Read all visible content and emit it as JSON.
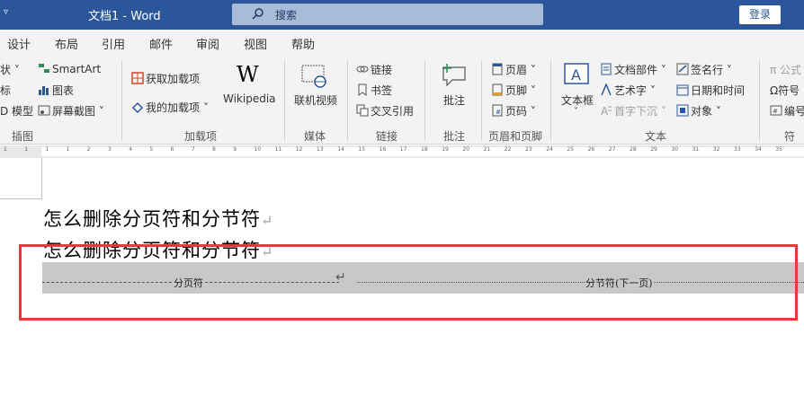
{
  "window": {
    "caret": "▿",
    "title": "文档1  -  Word",
    "search_label": "搜索",
    "login_label": "登录"
  },
  "tabs": [
    "设计",
    "布局",
    "引用",
    "邮件",
    "审阅",
    "视图",
    "帮助"
  ],
  "ribbon": {
    "illustrations": {
      "items": [
        "状 ˅",
        "标",
        "D 模型",
        "SmartArt",
        "图表",
        "屏幕截图 ˅"
      ],
      "group_label": "插图"
    },
    "addins": {
      "get_addins": "获取加载项",
      "my_addins": "我的加载项",
      "wikipedia_glyph": "W",
      "wikipedia": "Wikipedia",
      "group_label": "加载项"
    },
    "media": {
      "online_video": "联机视频",
      "group_label": "媒体"
    },
    "links": {
      "link": "链接",
      "bookmark": "书签",
      "cross_ref": "交叉引用",
      "group_label": "链接"
    },
    "comments": {
      "comment": "批注",
      "group_label": "批注"
    },
    "header_footer": {
      "header": "页眉 ˅",
      "footer": "页脚 ˅",
      "page_number": "页码 ˅",
      "group_label": "页眉和页脚"
    },
    "text": {
      "textbox": "文本框",
      "quick_parts": "文档部件 ˅",
      "wordart": "艺术字 ˅",
      "dropcap": "首字下沉 ˅",
      "signature": "签名行 ˅",
      "datetime": "日期和时间",
      "object": "对象 ˅",
      "group_label": "文本"
    },
    "symbols": {
      "equation": "公式",
      "symbol": "符号",
      "number": "编号",
      "group_label": "符号"
    }
  },
  "ruler": [
    "1",
    "1",
    "1",
    "1",
    "2",
    "3",
    "4",
    "5",
    "6",
    "7",
    "8",
    "9",
    "10",
    "11",
    "12",
    "13",
    "14",
    "15",
    "16",
    "17",
    "18",
    "19",
    "20",
    "21",
    "22",
    "23",
    "24",
    "25",
    "26",
    "27",
    "28",
    "29",
    "30",
    "31",
    "32",
    "33",
    "34",
    "35"
  ],
  "document": {
    "line1": "怎么删除分页符和分节符",
    "line2": "怎么删除分页符和分节符",
    "para_mark": "↵",
    "page_break": "分页符",
    "section_break": "分节符(下一页)"
  },
  "colors": {
    "titlebar": "#2b579a",
    "highlight_box": "#e53b3b",
    "break_bg": "#c8c8c8"
  }
}
